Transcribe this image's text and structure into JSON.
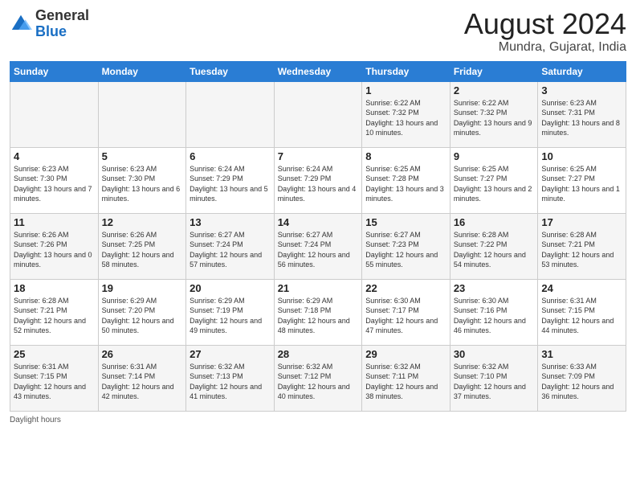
{
  "header": {
    "logo_line1": "General",
    "logo_line2": "Blue",
    "month_year": "August 2024",
    "location": "Mundra, Gujarat, India"
  },
  "days_of_week": [
    "Sunday",
    "Monday",
    "Tuesday",
    "Wednesday",
    "Thursday",
    "Friday",
    "Saturday"
  ],
  "footer": {
    "daylight_label": "Daylight hours"
  },
  "weeks": [
    [
      {
        "day": "",
        "sunrise": "",
        "sunset": "",
        "daylight": ""
      },
      {
        "day": "",
        "sunrise": "",
        "sunset": "",
        "daylight": ""
      },
      {
        "day": "",
        "sunrise": "",
        "sunset": "",
        "daylight": ""
      },
      {
        "day": "",
        "sunrise": "",
        "sunset": "",
        "daylight": ""
      },
      {
        "day": "1",
        "sunrise": "Sunrise: 6:22 AM",
        "sunset": "Sunset: 7:32 PM",
        "daylight": "Daylight: 13 hours and 10 minutes."
      },
      {
        "day": "2",
        "sunrise": "Sunrise: 6:22 AM",
        "sunset": "Sunset: 7:32 PM",
        "daylight": "Daylight: 13 hours and 9 minutes."
      },
      {
        "day": "3",
        "sunrise": "Sunrise: 6:23 AM",
        "sunset": "Sunset: 7:31 PM",
        "daylight": "Daylight: 13 hours and 8 minutes."
      }
    ],
    [
      {
        "day": "4",
        "sunrise": "Sunrise: 6:23 AM",
        "sunset": "Sunset: 7:30 PM",
        "daylight": "Daylight: 13 hours and 7 minutes."
      },
      {
        "day": "5",
        "sunrise": "Sunrise: 6:23 AM",
        "sunset": "Sunset: 7:30 PM",
        "daylight": "Daylight: 13 hours and 6 minutes."
      },
      {
        "day": "6",
        "sunrise": "Sunrise: 6:24 AM",
        "sunset": "Sunset: 7:29 PM",
        "daylight": "Daylight: 13 hours and 5 minutes."
      },
      {
        "day": "7",
        "sunrise": "Sunrise: 6:24 AM",
        "sunset": "Sunset: 7:29 PM",
        "daylight": "Daylight: 13 hours and 4 minutes."
      },
      {
        "day": "8",
        "sunrise": "Sunrise: 6:25 AM",
        "sunset": "Sunset: 7:28 PM",
        "daylight": "Daylight: 13 hours and 3 minutes."
      },
      {
        "day": "9",
        "sunrise": "Sunrise: 6:25 AM",
        "sunset": "Sunset: 7:27 PM",
        "daylight": "Daylight: 13 hours and 2 minutes."
      },
      {
        "day": "10",
        "sunrise": "Sunrise: 6:25 AM",
        "sunset": "Sunset: 7:27 PM",
        "daylight": "Daylight: 13 hours and 1 minute."
      }
    ],
    [
      {
        "day": "11",
        "sunrise": "Sunrise: 6:26 AM",
        "sunset": "Sunset: 7:26 PM",
        "daylight": "Daylight: 13 hours and 0 minutes."
      },
      {
        "day": "12",
        "sunrise": "Sunrise: 6:26 AM",
        "sunset": "Sunset: 7:25 PM",
        "daylight": "Daylight: 12 hours and 58 minutes."
      },
      {
        "day": "13",
        "sunrise": "Sunrise: 6:27 AM",
        "sunset": "Sunset: 7:24 PM",
        "daylight": "Daylight: 12 hours and 57 minutes."
      },
      {
        "day": "14",
        "sunrise": "Sunrise: 6:27 AM",
        "sunset": "Sunset: 7:24 PM",
        "daylight": "Daylight: 12 hours and 56 minutes."
      },
      {
        "day": "15",
        "sunrise": "Sunrise: 6:27 AM",
        "sunset": "Sunset: 7:23 PM",
        "daylight": "Daylight: 12 hours and 55 minutes."
      },
      {
        "day": "16",
        "sunrise": "Sunrise: 6:28 AM",
        "sunset": "Sunset: 7:22 PM",
        "daylight": "Daylight: 12 hours and 54 minutes."
      },
      {
        "day": "17",
        "sunrise": "Sunrise: 6:28 AM",
        "sunset": "Sunset: 7:21 PM",
        "daylight": "Daylight: 12 hours and 53 minutes."
      }
    ],
    [
      {
        "day": "18",
        "sunrise": "Sunrise: 6:28 AM",
        "sunset": "Sunset: 7:21 PM",
        "daylight": "Daylight: 12 hours and 52 minutes."
      },
      {
        "day": "19",
        "sunrise": "Sunrise: 6:29 AM",
        "sunset": "Sunset: 7:20 PM",
        "daylight": "Daylight: 12 hours and 50 minutes."
      },
      {
        "day": "20",
        "sunrise": "Sunrise: 6:29 AM",
        "sunset": "Sunset: 7:19 PM",
        "daylight": "Daylight: 12 hours and 49 minutes."
      },
      {
        "day": "21",
        "sunrise": "Sunrise: 6:29 AM",
        "sunset": "Sunset: 7:18 PM",
        "daylight": "Daylight: 12 hours and 48 minutes."
      },
      {
        "day": "22",
        "sunrise": "Sunrise: 6:30 AM",
        "sunset": "Sunset: 7:17 PM",
        "daylight": "Daylight: 12 hours and 47 minutes."
      },
      {
        "day": "23",
        "sunrise": "Sunrise: 6:30 AM",
        "sunset": "Sunset: 7:16 PM",
        "daylight": "Daylight: 12 hours and 46 minutes."
      },
      {
        "day": "24",
        "sunrise": "Sunrise: 6:31 AM",
        "sunset": "Sunset: 7:15 PM",
        "daylight": "Daylight: 12 hours and 44 minutes."
      }
    ],
    [
      {
        "day": "25",
        "sunrise": "Sunrise: 6:31 AM",
        "sunset": "Sunset: 7:15 PM",
        "daylight": "Daylight: 12 hours and 43 minutes."
      },
      {
        "day": "26",
        "sunrise": "Sunrise: 6:31 AM",
        "sunset": "Sunset: 7:14 PM",
        "daylight": "Daylight: 12 hours and 42 minutes."
      },
      {
        "day": "27",
        "sunrise": "Sunrise: 6:32 AM",
        "sunset": "Sunset: 7:13 PM",
        "daylight": "Daylight: 12 hours and 41 minutes."
      },
      {
        "day": "28",
        "sunrise": "Sunrise: 6:32 AM",
        "sunset": "Sunset: 7:12 PM",
        "daylight": "Daylight: 12 hours and 40 minutes."
      },
      {
        "day": "29",
        "sunrise": "Sunrise: 6:32 AM",
        "sunset": "Sunset: 7:11 PM",
        "daylight": "Daylight: 12 hours and 38 minutes."
      },
      {
        "day": "30",
        "sunrise": "Sunrise: 6:32 AM",
        "sunset": "Sunset: 7:10 PM",
        "daylight": "Daylight: 12 hours and 37 minutes."
      },
      {
        "day": "31",
        "sunrise": "Sunrise: 6:33 AM",
        "sunset": "Sunset: 7:09 PM",
        "daylight": "Daylight: 12 hours and 36 minutes."
      }
    ]
  ]
}
